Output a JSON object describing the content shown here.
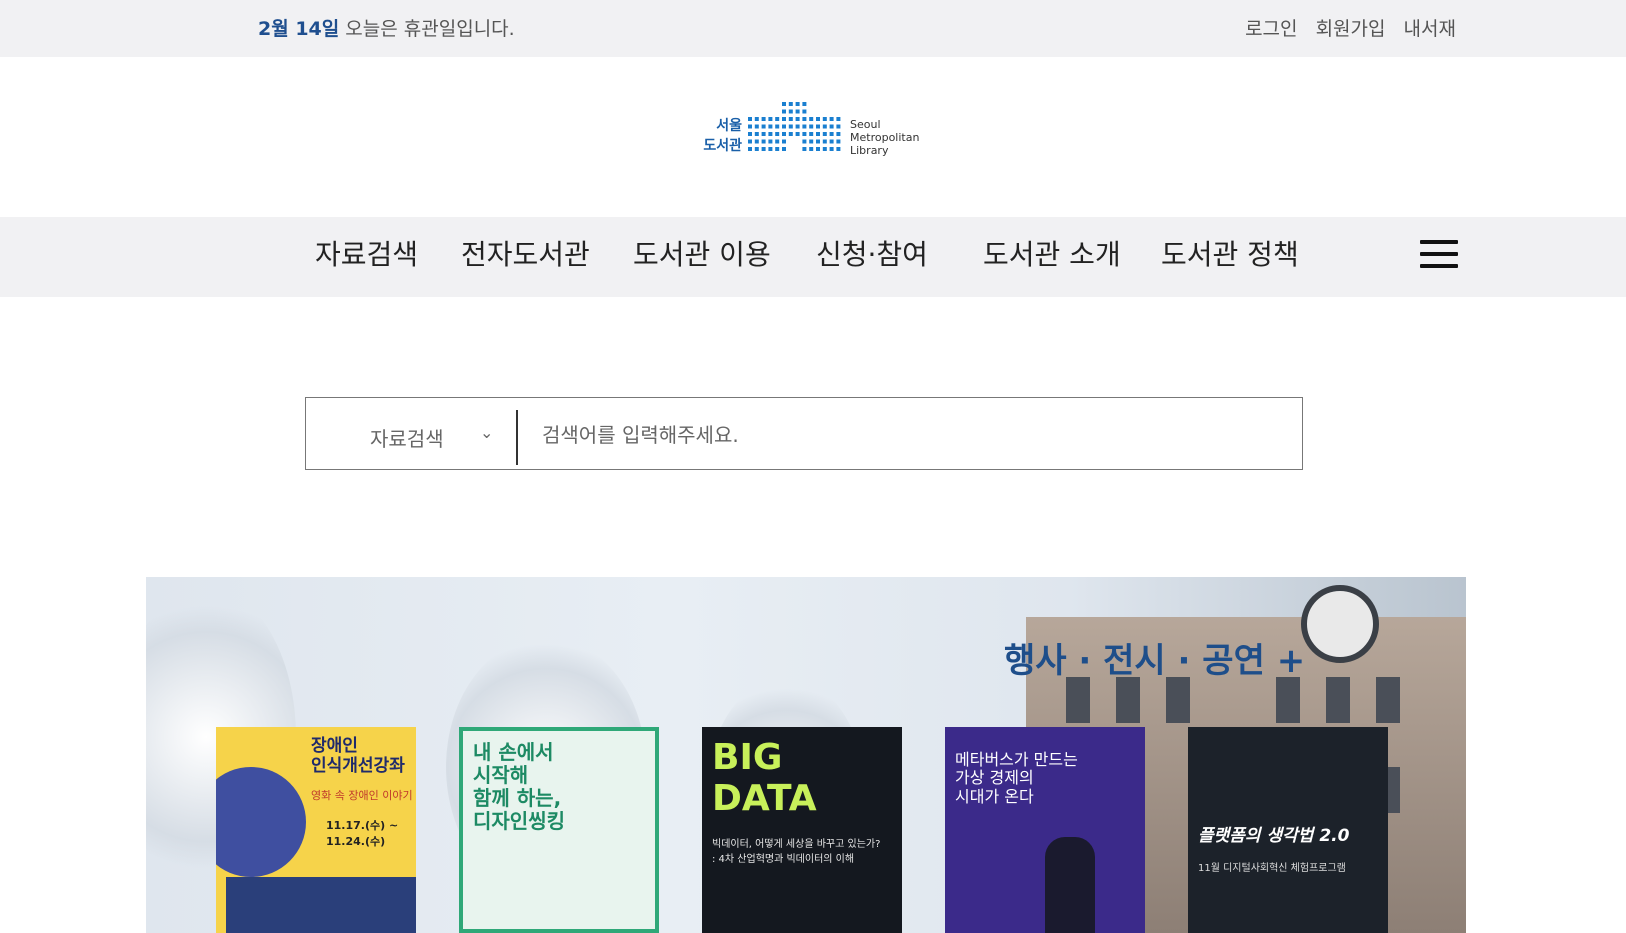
{
  "topbar": {
    "date": "2월 14일",
    "notice": "오늘은 휴관일입니다.",
    "links": [
      "로그인",
      "회원가입",
      "내서재"
    ]
  },
  "logo": {
    "ko_line1": "서울",
    "ko_line2": "도서관",
    "en_line1": "Seoul",
    "en_line2": "Metropolitan",
    "en_line3": "Library"
  },
  "nav": {
    "items": [
      "자료검색",
      "전자도서관",
      "도서관 이용",
      "신청·참여",
      "도서관 소개",
      "도서관 정책"
    ],
    "menu_icon": "hamburger-icon"
  },
  "search": {
    "category": "자료검색",
    "placeholder": "검색어를 입력해주세요."
  },
  "banner": {
    "title": "행사 · 전시 · 공연 +",
    "posters": [
      {
        "title": "장애인\n인식개선강좌",
        "subtitle": "영화 속 장애인 이야기",
        "dates": "11.17.(수) ~ 11.24.(수)"
      },
      {
        "title": "내 손에서\n시작해\n함께 하는,\n디자인씽킹",
        "subtitle": "",
        "dates": ""
      },
      {
        "title": "BIG\nDATA",
        "subtitle": "빅데이터, 어떻게 세상을 바꾸고 있는가?\n: 4차 산업혁명과 빅데이터의 이해",
        "dates": ""
      },
      {
        "title": "메타버스가 만드는\n가상 경제의\n시대가 온다",
        "subtitle": "",
        "dates": ""
      },
      {
        "title": "플랫폼의 생각법 2.0",
        "subtitle": "11월 디지털사회혁신 체험프로그램",
        "dates": ""
      }
    ]
  },
  "colors": {
    "brand_blue": "#1f4f8f",
    "logo_blue": "#1a5fa8",
    "topbar_bg": "#f1f1f3"
  }
}
